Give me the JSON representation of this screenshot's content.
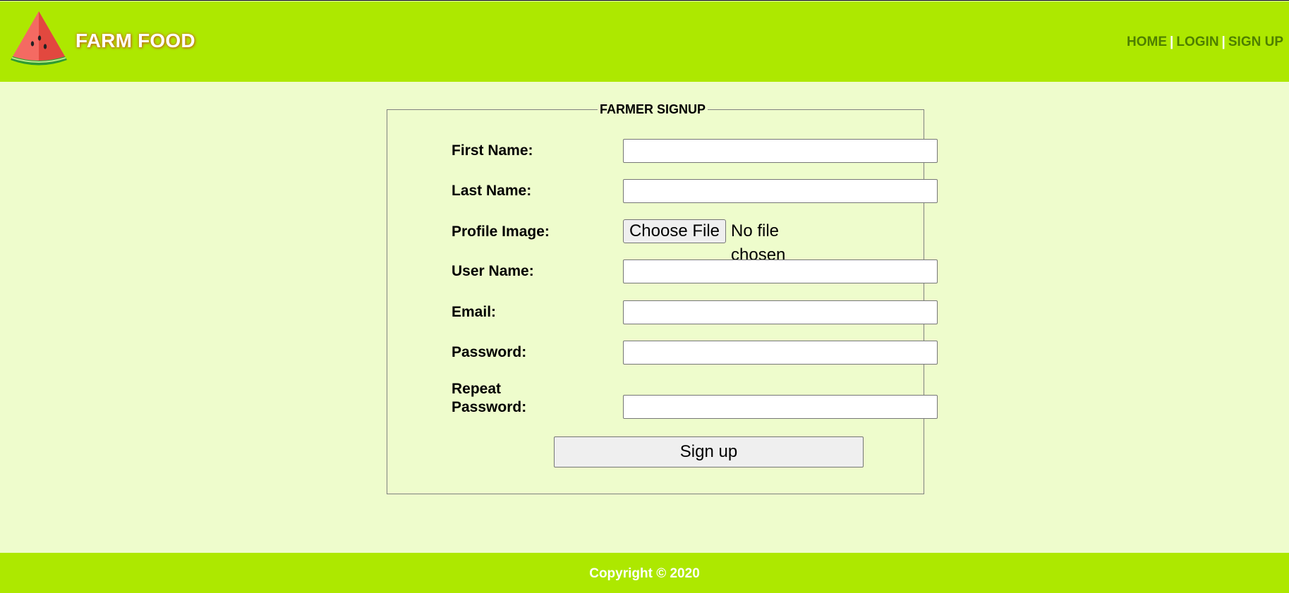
{
  "header": {
    "brand": "FARM FOOD",
    "logo_icon": "watermelon-slice-icon",
    "nav": {
      "home": "HOME",
      "separator": "|",
      "login": "LOGIN",
      "signup": "SIGN UP"
    }
  },
  "form": {
    "legend": "FARMER SIGNUP",
    "fields": [
      {
        "label": "First Name:",
        "value": ""
      },
      {
        "label": "Last Name:",
        "value": ""
      },
      {
        "label": "Profile Image:",
        "button": "Choose File",
        "status": "No file chosen"
      },
      {
        "label": "User Name:",
        "value": ""
      },
      {
        "label": "Email:",
        "value": ""
      },
      {
        "label": "Password:",
        "value": ""
      },
      {
        "label_line1": "Repeat",
        "label_line2": "Password:",
        "value": ""
      }
    ],
    "submit_label": "Sign up"
  },
  "footer": {
    "copyright": "Copyright © 2020"
  },
  "colors": {
    "header_bg": "#ade800",
    "page_bg": "#eefccc",
    "nav_link": "#4e7f00"
  }
}
